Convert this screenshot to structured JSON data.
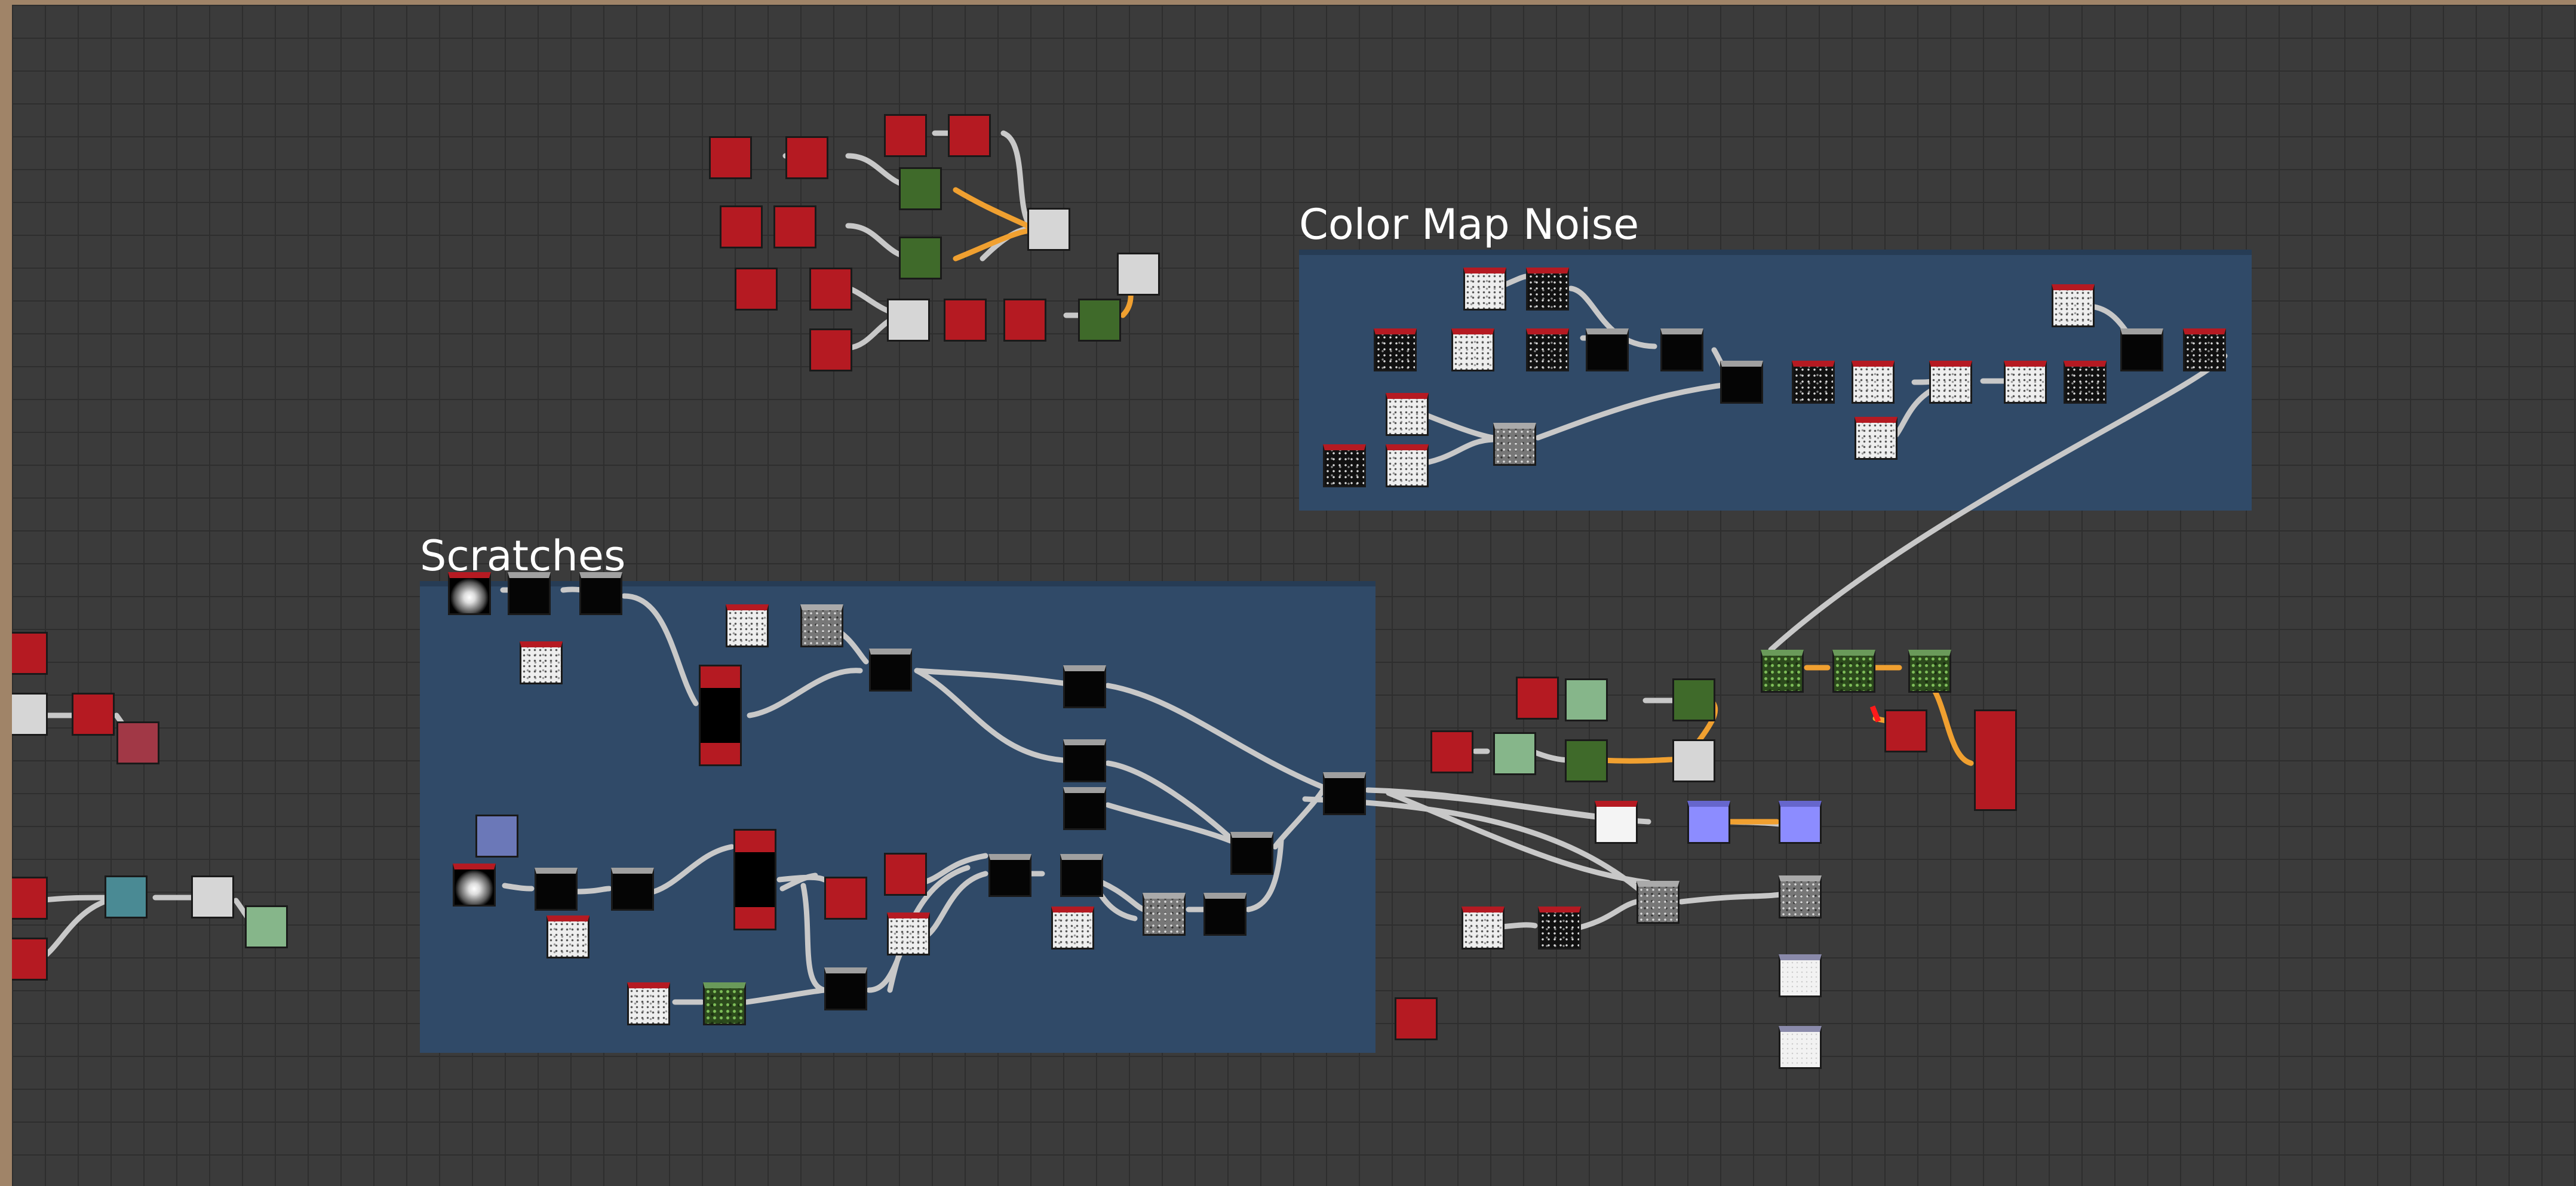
{
  "graph": {
    "frames": [
      {
        "id": "color-map-noise",
        "title": "Color Map Noise"
      },
      {
        "id": "scratches",
        "title": "Scratches"
      }
    ]
  },
  "colors": {
    "canvas_background": "#3b3b3b",
    "frame_fill": "#304a68",
    "wire_gray": "#c8c8c8",
    "wire_orange": "#f0a030",
    "node_red": "#b51a22",
    "node_green": "#3f6a2a",
    "node_violet": "#8c8cff"
  }
}
